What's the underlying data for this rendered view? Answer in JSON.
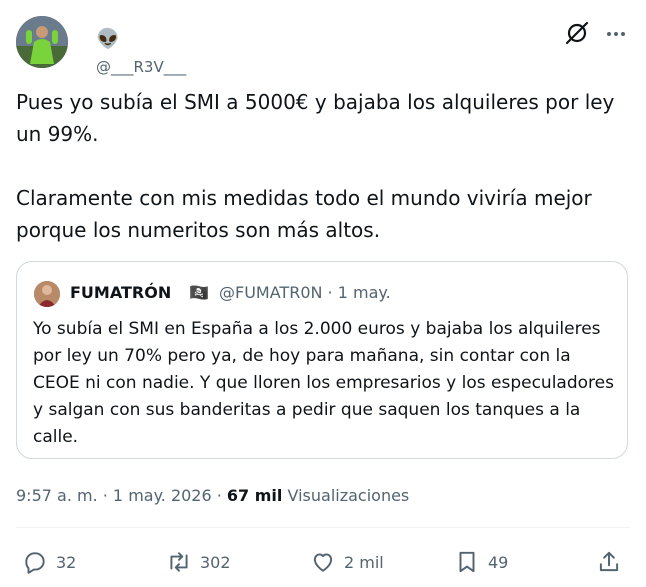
{
  "author": {
    "display_name": "👽",
    "handle": "@___R3V___"
  },
  "tweet": {
    "paragraphs": [
      "Pues yo subía el SMI a 5000€ y bajaba los alquileres por ley un 99%.",
      "Claramente con mis medidas todo el mundo viviría mejor porque los numeritos son más altos."
    ]
  },
  "quote": {
    "name": "FUMATRÓN",
    "emoji": "🏴‍☠️",
    "meta": "@FUMATR0N · 1 may.",
    "text": "Yo subía el SMI en España a los 2.000 euros y bajaba los alquileres por ley un 70% pero ya, de hoy para mañana, sin contar con la CEOE ni con nadie. Y que lloren los empresarios y los especuladores y salgan con sus banderitas a pedir que saquen los tanques a la calle."
  },
  "meta": {
    "timestamp": "9:57 a. m. · 1 may. 2026 ·",
    "views_count": "67 mil",
    "views_label": "Visualizaciones"
  },
  "actions": {
    "replies": "32",
    "reposts": "302",
    "likes": "2 mil",
    "bookmarks": "49"
  },
  "icons": {
    "grok": "grok-icon",
    "more": "more-icon",
    "reply": "reply-icon",
    "repost": "repost-icon",
    "like": "heart-icon",
    "bookmark": "bookmark-icon",
    "share": "share-icon"
  },
  "colors": {
    "text": "#0f1419",
    "secondary": "#536471",
    "border": "#cfd9de"
  }
}
